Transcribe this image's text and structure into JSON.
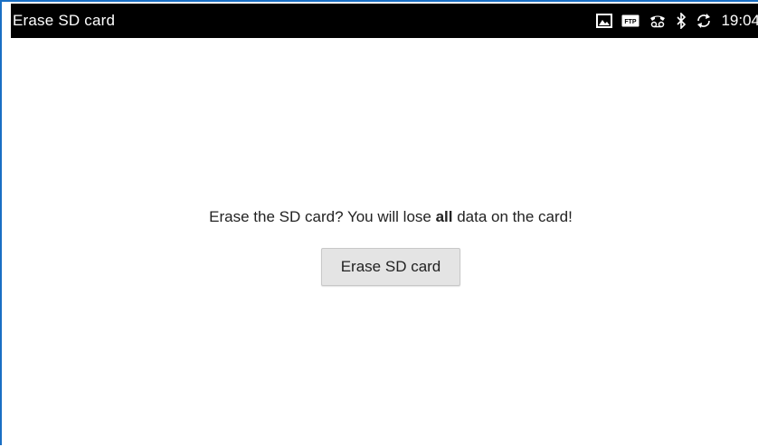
{
  "status_bar": {
    "title": "Erase SD card",
    "time": "19:04",
    "icons": [
      "picture-icon",
      "ftp-icon",
      "voicemail-icon",
      "bluetooth-icon",
      "sync-icon"
    ],
    "icon_labels": {
      "ftp": "FTP"
    }
  },
  "main": {
    "message_before": "Erase the SD card? You will lose ",
    "message_bold": "all",
    "message_after": " data on the card!",
    "button_label": "Erase SD card"
  },
  "colors": {
    "status_bar_bg": "#000000",
    "frame_accent": "#1a6fc4",
    "button_bg": "#e4e4e4"
  }
}
